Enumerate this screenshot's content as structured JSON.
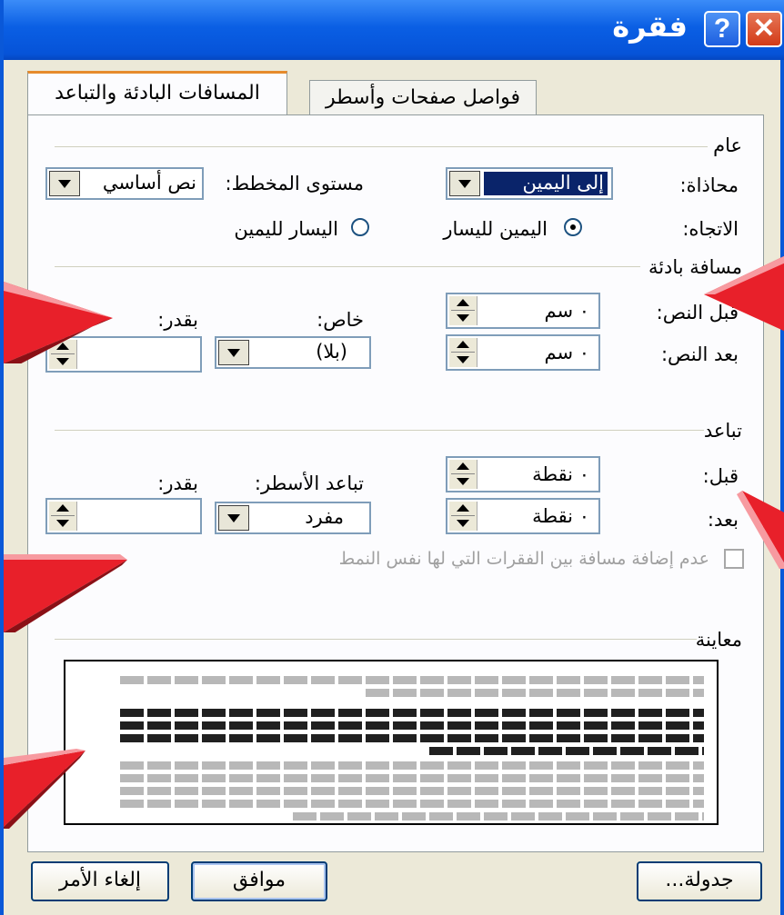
{
  "window": {
    "title": "فقرة",
    "help_label": "?",
    "close_label": "✕"
  },
  "tabs": [
    {
      "label": "المسافات البادئة والتباعد",
      "active": true
    },
    {
      "label": "فواصل صفحات وأسطر",
      "active": false
    }
  ],
  "general": {
    "section_label": "عام",
    "alignment_label": "محاذاة:",
    "alignment_value": "إلى اليمين",
    "outline_label": "مستوى المخطط:",
    "outline_value": "نص أساسي",
    "direction_label": "الاتجاه:",
    "rtl_label": "اليمين لليسار",
    "ltr_label": "اليسار لليمين",
    "rtl_selected": true
  },
  "indent": {
    "section_label": "مسافة بادئة",
    "before_label": "قبل النص:",
    "before_value": "٠ سم",
    "after_label": "بعد النص:",
    "after_value": "٠ سم",
    "special_label": "خاص:",
    "special_value": "(بلا)",
    "by_label": "بقدر:",
    "by_value": ""
  },
  "spacing": {
    "section_label": "تباعد",
    "before_label": "قبل:",
    "before_value": "٠ نقطة",
    "after_label": "بعد:",
    "after_value": "٠ نقطة",
    "line_label": "تباعد الأسطر:",
    "line_value": "مفرد",
    "at_label": "بقدر:",
    "at_value": "",
    "no_space_label": "عدم إضافة مسافة بين الفقرات التي لها نفس النمط"
  },
  "preview": {
    "section_label": "معاينة"
  },
  "buttons": {
    "tabs": "جدولة...",
    "ok": "موافق",
    "cancel": "إلغاء الأمر"
  },
  "colors": {
    "titlebar": "#0a5fe4",
    "dialog_bg": "#ece9d8",
    "tab_accent": "#e68b2c",
    "callout": "#e8202a"
  }
}
